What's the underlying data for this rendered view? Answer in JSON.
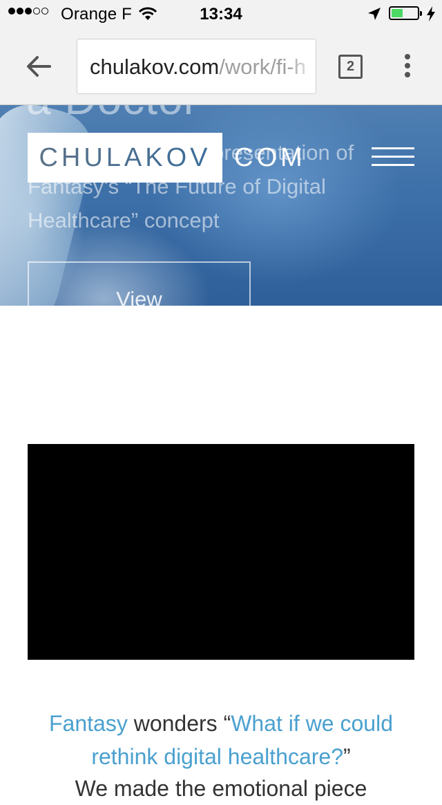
{
  "status_bar": {
    "carrier": "Orange F",
    "time": "13:34",
    "signal_bars_filled": 3,
    "signal_bars_total": 5,
    "battery_level": 0.45,
    "battery_color": "#4cd964",
    "icons": [
      "wifi-icon",
      "location-arrow-icon",
      "battery-icon",
      "charging-bolt-icon"
    ]
  },
  "browser": {
    "url_domain": "chulakov.com",
    "url_path": "/work/fi-h",
    "tab_count": "2",
    "icons": [
      "back-arrow-icon",
      "tabs-icon",
      "overflow-menu-icon"
    ]
  },
  "site_header": {
    "logo_main": "CHULAKOV",
    "logo_suffix": "COM",
    "icons": [
      "hamburger-menu-icon"
    ]
  },
  "hero": {
    "title_partial": "a Doctor",
    "description": "A compelling video presentation of Fantasy’s “The Future of Digital Healthcare” concept",
    "button_label": "View"
  },
  "content": {
    "intro_brand": "Fantasy",
    "intro_verb": " wonders “",
    "intro_question": "What if we could rethink digital healthcare?",
    "intro_close": "”",
    "next_line_partial": "We made the emotional piece"
  },
  "colors": {
    "accent": "#4aa0cf",
    "toolbar_bg": "#f2f2f2",
    "hero_blue": "#3d6fa8",
    "video_bg": "#000000"
  }
}
